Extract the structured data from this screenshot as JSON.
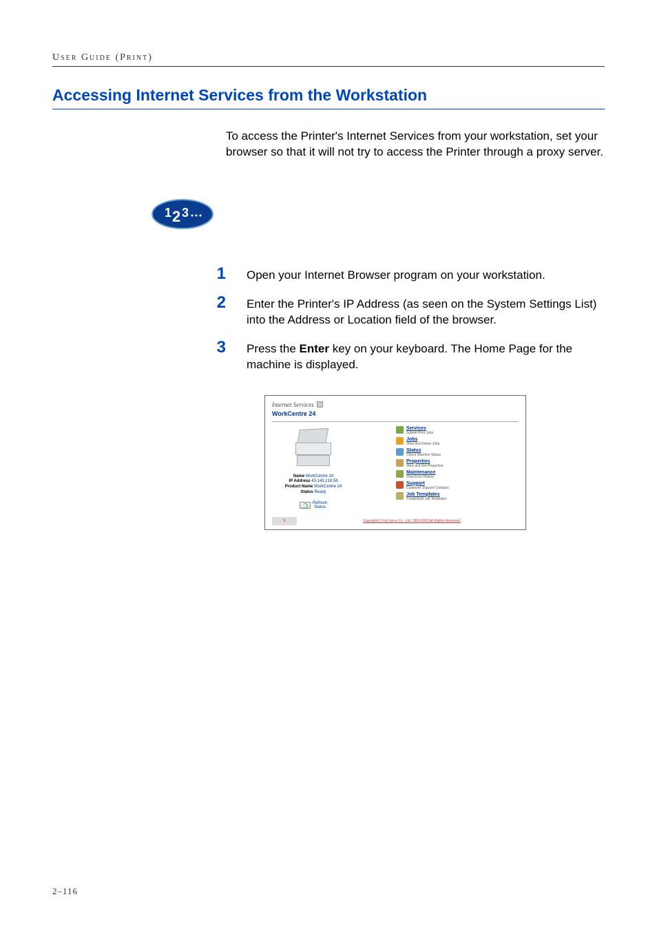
{
  "running_header": "User Guide (Print)",
  "section_title": "Accessing Internet Services from the Workstation",
  "intro_text": "To access the Printer's Internet Services from your workstation, set your browser so that it will not try to access the Printer through a proxy server.",
  "steps_icon_alt": "123...",
  "steps": [
    {
      "num": "1",
      "text": "Open your Internet Browser program on your workstation."
    },
    {
      "num": "2",
      "text": "Enter the Printer's IP Address (as seen on the System Settings List) into the Address or Location field of the browser."
    },
    {
      "num": "3",
      "pre": "Press the ",
      "bold": "Enter",
      "post": " key on your keyboard. The Home Page for the machine is displayed."
    }
  ],
  "screenshot": {
    "app_title": "Internet Services",
    "device": "WorkCentre 24",
    "meta": {
      "name_label": "Name",
      "name_value": "WorkCentre 24",
      "ip_label": "IP Address",
      "ip_value": "43.143.218.58",
      "product_label": "Product Name",
      "product_value": "WorkCentre 24",
      "status_label": "Status",
      "status_value": "Ready"
    },
    "refresh": {
      "line1": "Refresh",
      "line2": "Status"
    },
    "links": [
      {
        "title": "Services",
        "sub": "Submit Print Jobs"
      },
      {
        "title": "Jobs",
        "sub": "View and Delete Jobs"
      },
      {
        "title": "Status",
        "sub": "Check Machine Status"
      },
      {
        "title": "Properties",
        "sub": "View and Set Properties"
      },
      {
        "title": "Maintenance",
        "sub": "View Error History"
      },
      {
        "title": "Support",
        "sub": "Customer Support Contacts"
      },
      {
        "title": "Job Templates",
        "sub": "Create/Edit Job Templates"
      }
    ],
    "footer_logo_text": "X",
    "footer_copyright": "Copyright © Fuji Xerox Co., Ltd. 1999-2003 All Rights Reserved."
  },
  "page_number": "2–116"
}
